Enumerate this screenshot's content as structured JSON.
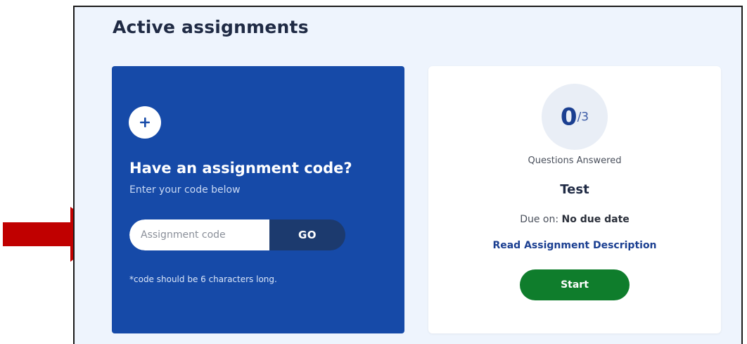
{
  "section": {
    "title": "Active assignments"
  },
  "code_card": {
    "plus_icon": "plus-icon",
    "heading": "Have an assignment code?",
    "subtitle": "Enter your code below",
    "input_placeholder": "Assignment code",
    "input_value": "",
    "go_label": "GO",
    "hint": "*code should be 6 characters long.",
    "background_color": "#164aa8",
    "go_color": "#1c3a6e"
  },
  "assignment": {
    "answered": "0",
    "total": "/3",
    "questions_label": "Questions Answered",
    "name": "Test",
    "due_prefix": "Due on: ",
    "due_value": "No due date",
    "description_link": "Read Assignment Description",
    "start_label": "Start",
    "start_color": "#0f7d2c"
  },
  "annotation": {
    "arrow_icon": "red-arrow-right-icon",
    "arrow_color": "#c00000"
  }
}
